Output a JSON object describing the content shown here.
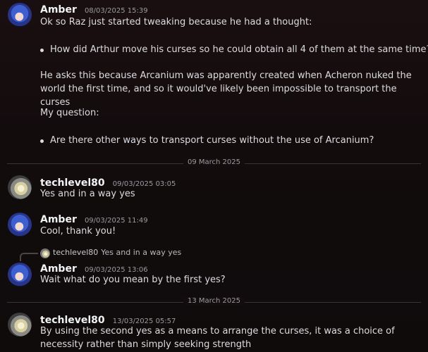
{
  "messages": [
    {
      "author": "Amber",
      "timestamp": "08/03/2025 15:39",
      "line1": "Ok so Raz just started tweaking because he had a thought:",
      "bullet1": "How did Arthur move his curses so he could obtain all 4 of them at the same time?",
      "para": "He asks this because Arcanium was apparently created when Acheron nuked the world the first time, and so it would've likely been impossible to transport the curses",
      "question_label": "My question:",
      "bullet2": "Are there other ways to transport curses without the use of Arcanium?"
    },
    {
      "author": "techlevel80",
      "timestamp": "09/03/2025 03:05",
      "text": "Yes and in a way yes"
    },
    {
      "author": "Amber",
      "timestamp": "09/03/2025 11:49",
      "text": "Cool, thank you!"
    },
    {
      "reply_author": "techlevel80",
      "reply_text": "Yes and in a way yes",
      "author": "Amber",
      "timestamp": "09/03/2025 13:06",
      "text": "Wait what do you mean by the first yes?"
    },
    {
      "author": "techlevel80",
      "timestamp": "13/03/2025 05:57",
      "text": "By using the second yes as a means to arrange the curses, it was a choice of necessity rather than simply seeking strength"
    }
  ],
  "dividers": [
    "09 March 2025",
    "13 March 2025"
  ]
}
